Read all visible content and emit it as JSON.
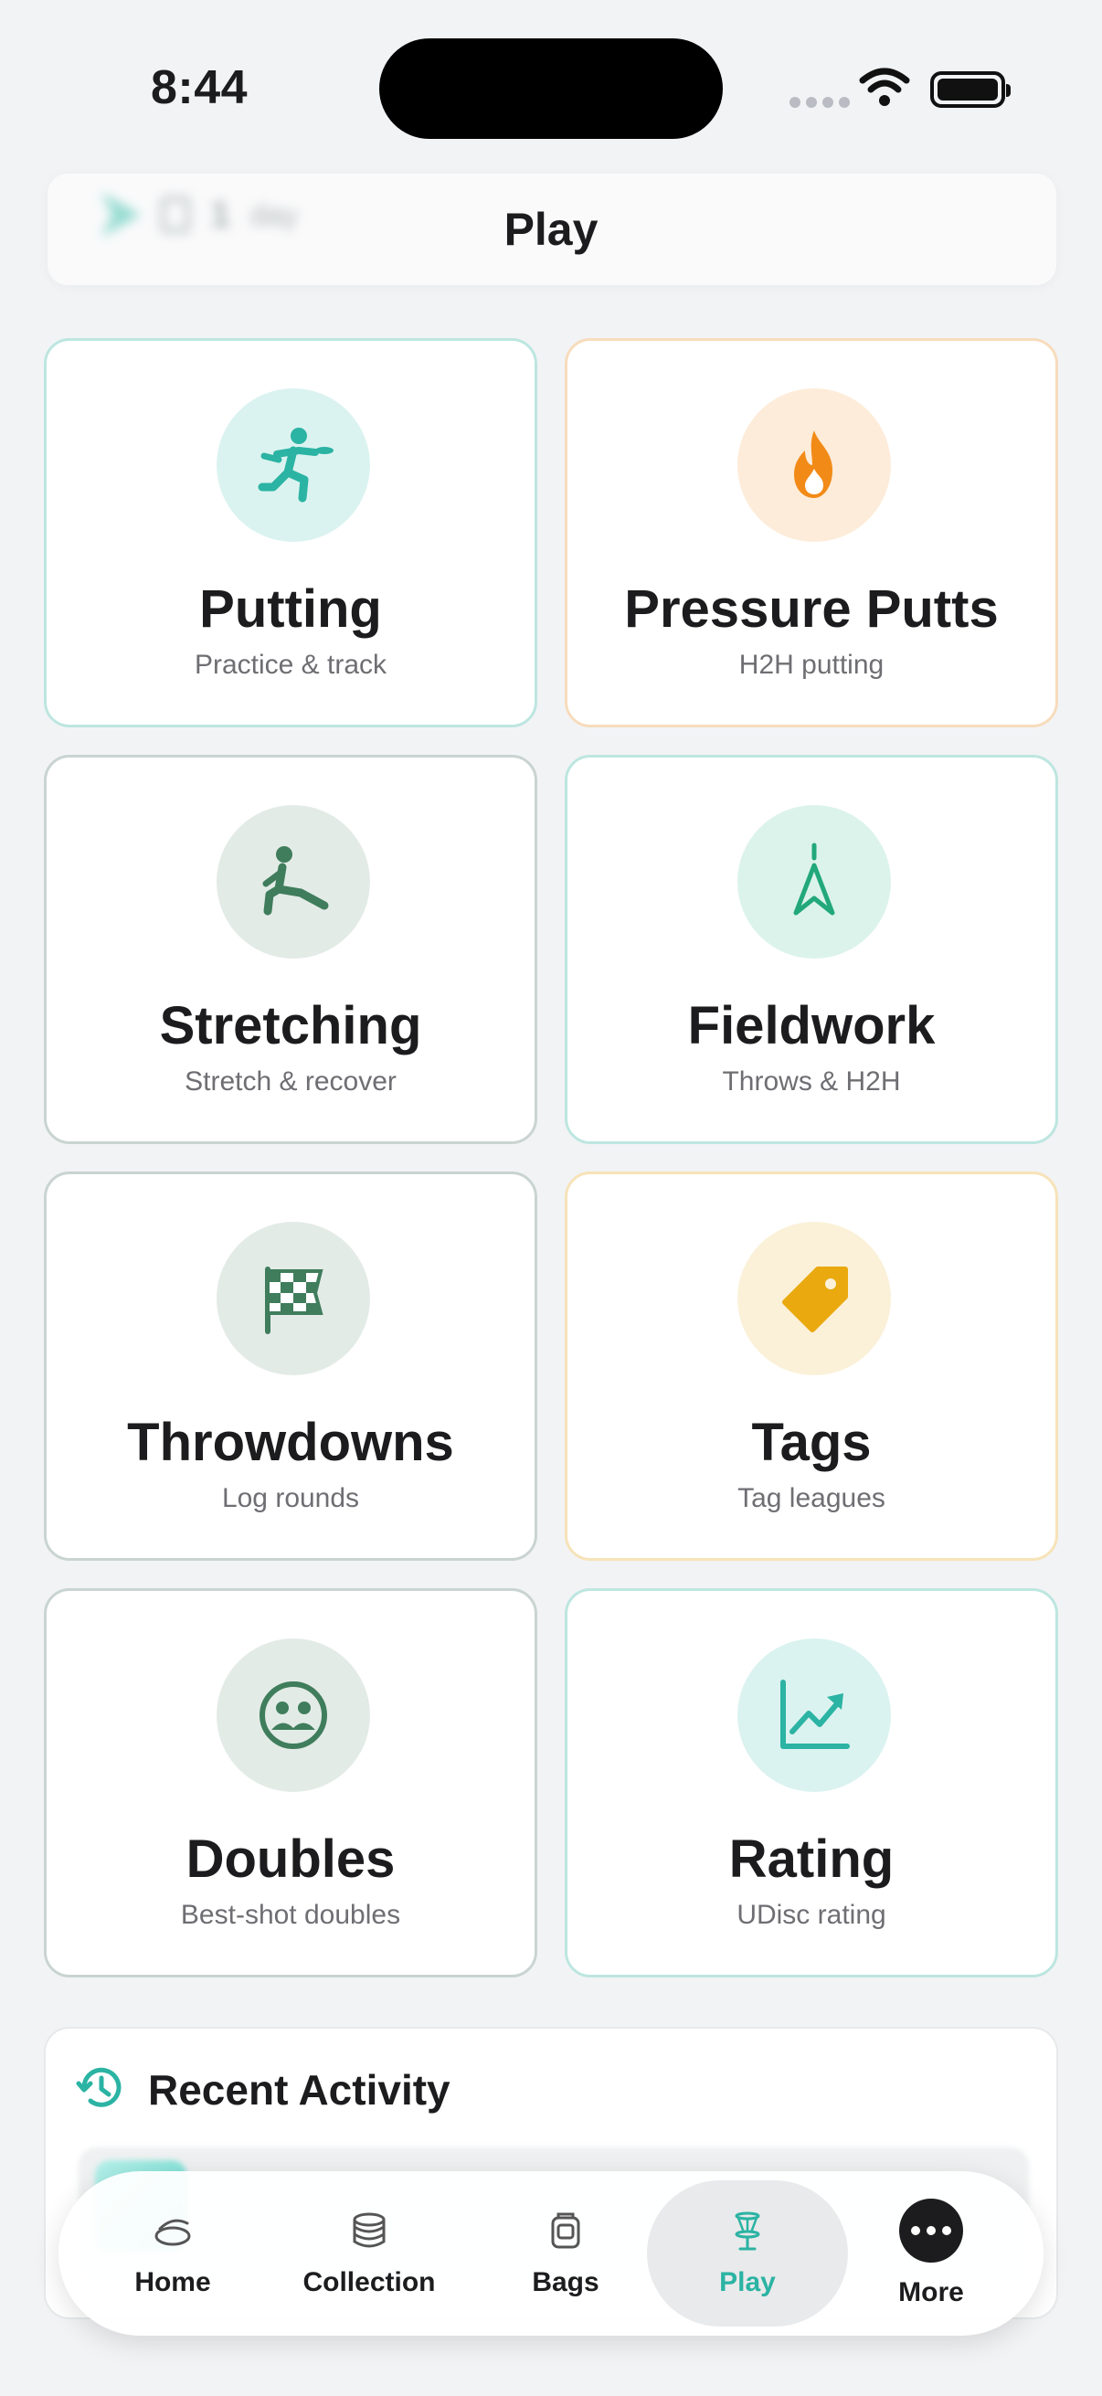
{
  "status_bar": {
    "time": "8:44"
  },
  "header": {
    "title": "Play",
    "ghost_text": "1",
    "ghost_sub": "day"
  },
  "tiles": [
    {
      "title": "Putting",
      "subtitle": "Practice & track",
      "icon": "frisbee-throw-icon",
      "accent": "#2bb3a3",
      "bg": "#dbf3f0"
    },
    {
      "title": "Pressure Putts",
      "subtitle": "H2H putting",
      "icon": "flame-icon",
      "accent": "#f28a17",
      "bg": "#fdecd9"
    },
    {
      "title": "Stretching",
      "subtitle": "Stretch & recover",
      "icon": "stretch-person-icon",
      "accent": "#3f7d5c",
      "bg": "#e3ebe7"
    },
    {
      "title": "Fieldwork",
      "subtitle": "Throws & H2H",
      "icon": "compass-icon",
      "accent": "#22a87a",
      "bg": "#dcf3ec"
    },
    {
      "title": "Throwdowns",
      "subtitle": "Log rounds",
      "icon": "checkered-flag-icon",
      "accent": "#3f7d5c",
      "bg": "#e3ebe7"
    },
    {
      "title": "Tags",
      "subtitle": "Tag leagues",
      "icon": "tag-icon",
      "accent": "#e9a90f",
      "bg": "#fbf1d9"
    },
    {
      "title": "Doubles",
      "subtitle": "Best-shot doubles",
      "icon": "group-icon",
      "accent": "#3f7d5c",
      "bg": "#e3ebe7"
    },
    {
      "title": "Rating",
      "subtitle": "UDisc rating",
      "icon": "chart-up-icon",
      "accent": "#2bb3a3",
      "bg": "#dbf3f0"
    }
  ],
  "recent_activity": {
    "title": "Recent Activity"
  },
  "tabbar": {
    "items": [
      {
        "label": "Home",
        "icon": "disc-icon"
      },
      {
        "label": "Collection",
        "icon": "stack-icon"
      },
      {
        "label": "Bags",
        "icon": "bag-icon"
      },
      {
        "label": "Play",
        "icon": "basket-icon",
        "active": true
      },
      {
        "label": "More",
        "icon": "ellipsis-icon"
      }
    ]
  }
}
